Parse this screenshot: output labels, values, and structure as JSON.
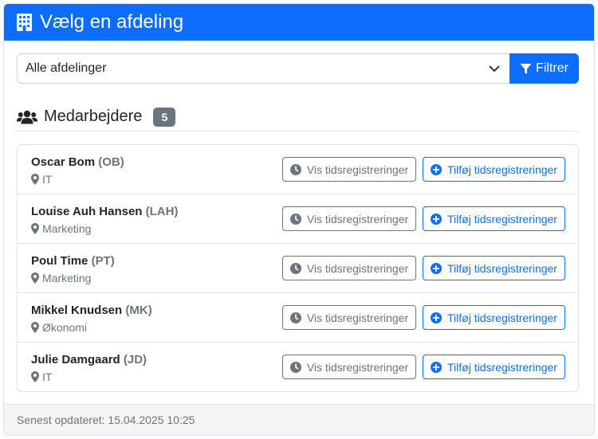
{
  "header": {
    "title": "Vælg en afdeling",
    "icon": "building-icon"
  },
  "filter": {
    "selected": "Alle afdelinger",
    "button_label": "Filtrer",
    "button_icon": "funnel-icon"
  },
  "section": {
    "title": "Medarbejdere",
    "count": "5",
    "icon": "users-icon"
  },
  "actions": {
    "view_label": "Vis tidsregistreringer",
    "add_label": "Tilføj tidsregistreringer"
  },
  "employees": [
    {
      "name": "Oscar Bom",
      "initials": "(OB)",
      "department": "IT"
    },
    {
      "name": "Louise Auh Hansen",
      "initials": "(LAH)",
      "department": "Marketing"
    },
    {
      "name": "Poul Time",
      "initials": "(PT)",
      "department": "Marketing"
    },
    {
      "name": "Mikkel Knudsen",
      "initials": "(MK)",
      "department": "Økonomi"
    },
    {
      "name": "Julie Damgaard",
      "initials": "(JD)",
      "department": "IT"
    }
  ],
  "footer": {
    "updated": "Senest opdateret: 15.04.2025 10:25"
  },
  "colors": {
    "primary": "#0d6efd",
    "secondary": "#6c757d",
    "border": "#dee2e6"
  }
}
